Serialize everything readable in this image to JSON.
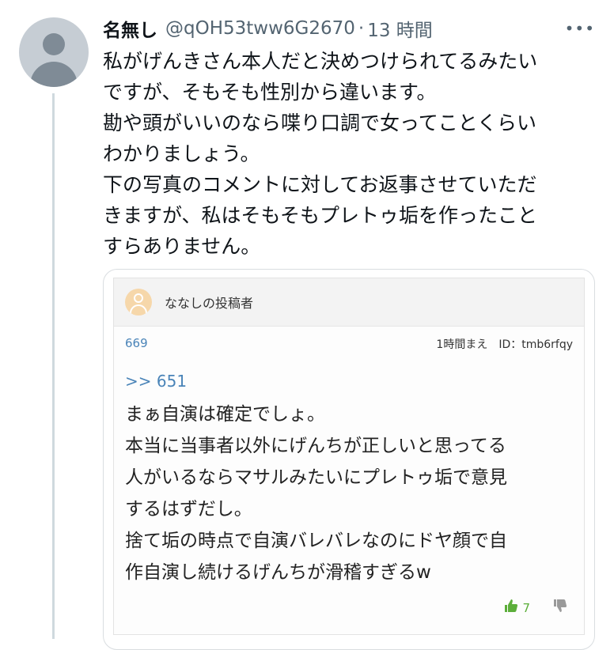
{
  "tweet": {
    "display_name": "名無し",
    "handle": "@qOH53tww6G2670",
    "separator": "·",
    "time": "13 時間",
    "more_icon": "more-horizontal-icon",
    "text_lines": [
      "私がげんきさん本人だと決めつけられてるみたい",
      "ですが、そもそも性別から違います。",
      "勘や頭がいいのなら喋り口調で女ってことくらい",
      "わかりましょう。",
      "下の写真のコメントに対してお返事させていただ",
      "きますが、私はそもそもプレトゥ垢を作ったこと",
      "すらありません。"
    ]
  },
  "card": {
    "poster_name": "ななしの投稿者",
    "post_number": "669",
    "post_time": "1時間まえ　ID：tmb6rfqy",
    "reply_link": ">> 651",
    "body_lines": [
      "まぁ自演は確定でしょ。",
      "本当に当事者以外にげんちが正しいと思ってる",
      "人がいるならマサルみたいにプレトゥ垢で意見",
      "するはずだし。",
      "捨て垢の時点で自演バレバレなのにドヤ顔で自",
      "作自演し続けるげんちが滑稽すぎるw"
    ],
    "upvote_count": "7",
    "upvote_icon": "thumbs-up-icon",
    "downvote_icon": "thumbs-down-icon"
  },
  "colors": {
    "link": "#4a84b8",
    "upvote": "#5cae3a",
    "muted": "#536471"
  }
}
